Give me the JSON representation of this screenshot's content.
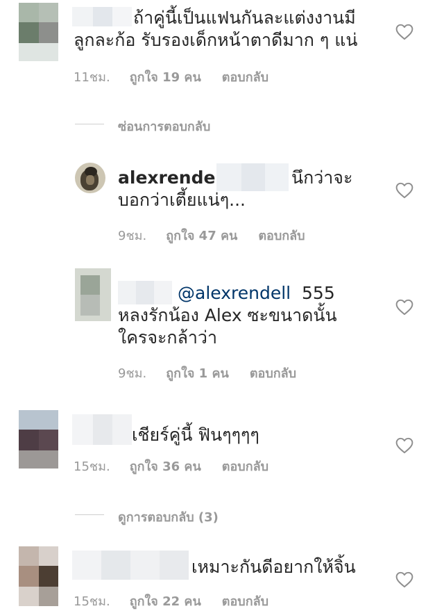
{
  "comments": [
    {
      "text": "ถ้าคู่นี้เป็นแฟนกันละแต่งงานมีลูกละก้อ รับรองเด็กหน้าตาดีมาก ๆ แน่",
      "time": "11ชม.",
      "likes": "ถูกใจ 19 คน",
      "reply": "ตอบกลับ"
    },
    {
      "username": "alexrendell",
      "text": "นึกว่าจะบอกว่าเตี้ยแน่ๆ...",
      "time": "9ชม.",
      "likes": "ถูกใจ 47 คน",
      "reply": "ตอบกลับ"
    },
    {
      "mention": "@alexrendell",
      "text": "555 หลงรักน้อง Alex ซะขนาดนั้น ใครจะกล้าว่า",
      "time": "9ชม.",
      "likes": "ถูกใจ 1 คน",
      "reply": "ตอบกลับ"
    },
    {
      "text": "เชียร์คู่นี้ ฟินๆๆๆๆ",
      "time": "15ชม.",
      "likes": "ถูกใจ 36 คน",
      "reply": "ตอบกลับ"
    },
    {
      "text": "เหมาะกันดีอยากให้จิ้น",
      "time": "15ชม.",
      "likes": "ถูกใจ 22 คน",
      "reply": "ตอบกลับ"
    }
  ],
  "threads": {
    "hide_replies": "ซ่อนการตอบกลับ",
    "view_replies": "ดูการตอบกลับ (3)"
  },
  "colors": {
    "meta_gray": "#999999",
    "mention_blue": "#003569",
    "heart_gray": "#8e8e8e"
  }
}
